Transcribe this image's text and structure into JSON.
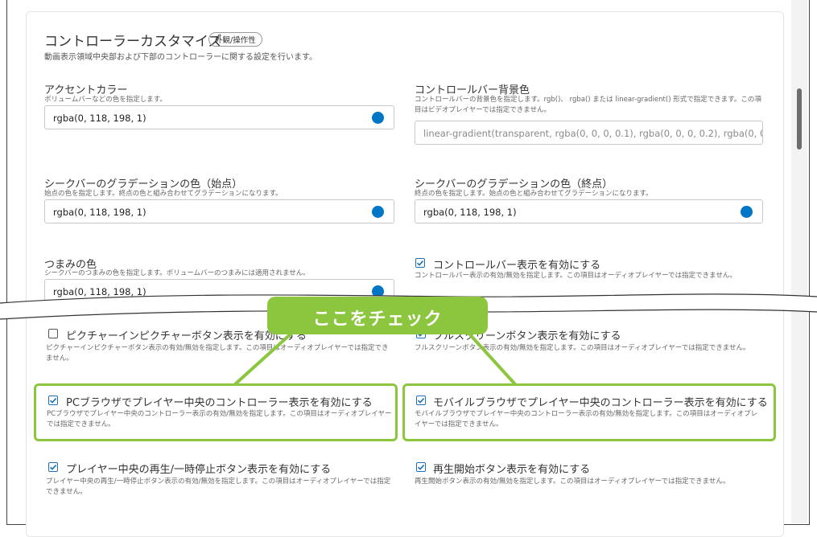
{
  "section": {
    "title": "コントローラーカスタマイズ",
    "badge": "外観/操作性",
    "description": "動画表示領域中央部および下部のコントローラーに関する設定を行います。"
  },
  "fields": {
    "accent_color": {
      "label": "アクセントカラー",
      "description": "ボリュームバーなどの色を指定します。",
      "value": "rgba(0, 118, 198, 1)",
      "swatch": "#0076c6"
    },
    "controlbar_bg": {
      "label": "コントロールバー背景色",
      "description": "コントロールバーの背景色を指定します。rgb()、 rgba() または linear-gradient() 形式で指定できます。この項目はビデオプレイヤーでは指定できません。",
      "placeholder": "linear-gradient(transparent, rgba(0, 0, 0, 0.1), rgba(0, 0, 0, 0.2), rgba(0, 0, 0, 0.3)"
    },
    "seek_gradient_start": {
      "label": "シークバーのグラデーションの色（始点）",
      "description": "始点の色を指定します。終点の色と組み合わせてグラデーションになります。",
      "value": "rgba(0, 118, 198, 1)",
      "swatch": "#0076c6"
    },
    "seek_gradient_end": {
      "label": "シークバーのグラデーションの色（終点）",
      "description": "終点の色を指定します。始点の色と組み合わせてグラデーションになります。",
      "value": "rgba(0, 118, 198, 1)",
      "swatch": "#0076c6"
    },
    "knob_color": {
      "label": "つまみの色",
      "description": "シークバーのつまみの色を指定します。ボリュームバーのつまみには適用されません。",
      "value": "rgba(0, 118, 198, 1)",
      "swatch": "#0076c6"
    }
  },
  "checkboxes": {
    "controlbar_display": {
      "label": "コントロールバー表示を有効にする",
      "description": "コントロールバー表示の有効/無効を指定します。この項目はオーディオプレイヤーでは指定できません。",
      "checked": true
    },
    "pip_button": {
      "label": "ピクチャーインピクチャーボタン表示を有効にする",
      "description": "ピクチャーインピクチャーボタン表示の有効/無効を指定します。この項目はオーディオプレイヤーでは指定できません。",
      "checked": false
    },
    "fullscreen_button": {
      "label": "フルスクリーンボタン表示を有効にする",
      "description": "フルスクリーンボタン表示の有効/無効を指定します。この項目はオーディオプレイヤーでは指定できません。",
      "checked": true
    },
    "pc_center_controller": {
      "label": "PCブラウザでプレイヤー中央のコントローラー表示を有効にする",
      "description": "PCブラウザでプレイヤー中央のコントローラー表示の有効/無効を指定します。この項目はオーディオプレイヤーでは指定できません。",
      "checked": true
    },
    "mobile_center_controller": {
      "label": "モバイルブラウザでプレイヤー中央のコントローラー表示を有効にする",
      "description": "モバイルブラウザでプレイヤー中央のコントローラー表示の有効/無効を指定します。この項目はオーディオプレイヤーでは指定できません。",
      "checked": true
    },
    "center_play_pause": {
      "label": "プレイヤー中央の再生/一時停止ボタン表示を有効にする",
      "description": "プレイヤー中央の再生/一時停止ボタン表示の有効/無効を指定します。この項目はオーディオプレイヤーでは指定できません。",
      "checked": true
    },
    "start_button": {
      "label": "再生開始ボタン表示を有効にする",
      "description": "再生開始ボタン表示の有効/無効を指定します。この項目はオーディオプレイヤーでは指定できません。",
      "checked": true
    }
  },
  "annotation": {
    "callout": "ここをチェック",
    "color": "#8cc63f"
  },
  "colors": {
    "checkbox": "#1c6fb8",
    "accent": "#0076c6"
  }
}
